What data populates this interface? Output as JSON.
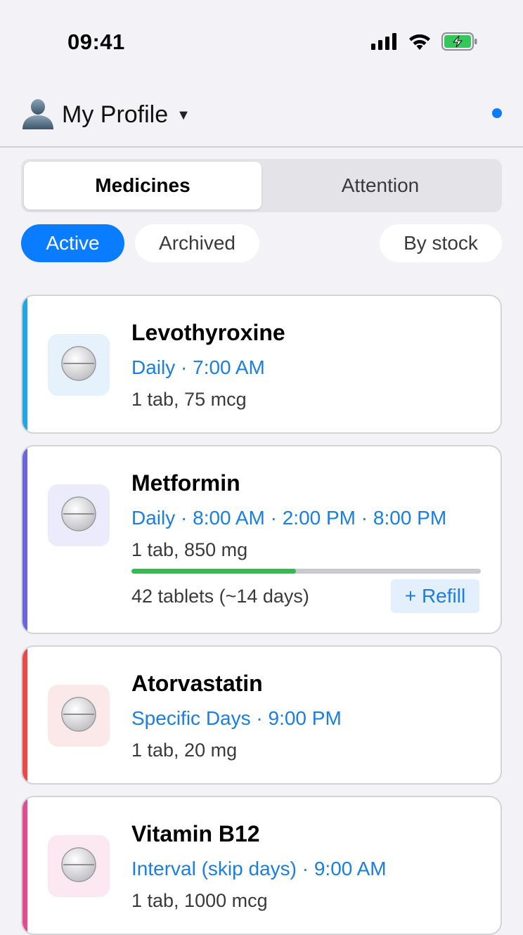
{
  "status_bar": {
    "time": "09:41",
    "icons": [
      "signal-icon",
      "wifi-icon",
      "battery-charging-icon"
    ]
  },
  "header": {
    "profile_icon": "person-icon",
    "title": "My Profile",
    "caret": "▼",
    "notification_dot_color": "#0a7cff"
  },
  "tabs": [
    {
      "label": "Medicines",
      "active": true
    },
    {
      "label": "Attention",
      "active": false
    }
  ],
  "filters": {
    "active": "Active",
    "archived": "Archived",
    "sort": "By stock"
  },
  "medicines": [
    {
      "name": "Levothyroxine",
      "schedule": "Daily · 7:00 AM",
      "dose": "1 tab, 75 mcg",
      "accent_color": "#1ea7e4",
      "icon_bg": "#e6f2fb",
      "icon": "pill-icon"
    },
    {
      "name": "Metformin",
      "schedule": "Daily · 8:00 AM · 2:00 PM · 8:00 PM",
      "dose": "1 tab, 850 mg",
      "accent_color": "#6b63e0",
      "icon_bg": "#ebebfb",
      "icon": "pill-icon",
      "stock_text": "42 tablets (~14 days)",
      "stock_fraction": 0.47,
      "refill_label": "+ Refill"
    },
    {
      "name": "Atorvastatin",
      "schedule": "Specific Days · 9:00 PM",
      "dose": "1 tab, 20 mg",
      "accent_color": "#ec4848",
      "icon_bg": "#fbe9e9",
      "icon": "pill-icon"
    },
    {
      "name": "Vitamin B12",
      "schedule": "Interval (skip days) · 9:00 AM",
      "dose": "1 tab, 1000 mcg",
      "accent_color": "#e34b91",
      "icon_bg": "#fbe8f0",
      "icon": "pill-icon"
    }
  ]
}
